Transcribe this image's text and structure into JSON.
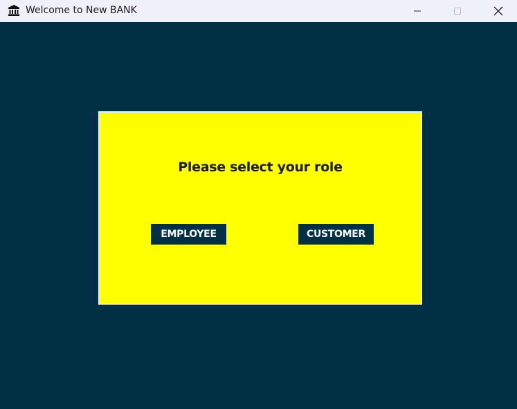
{
  "window": {
    "title": "Welcome to New BANK",
    "icon": "bank-icon"
  },
  "panel": {
    "prompt": "Please select your role",
    "background_color": "#ffff00",
    "buttons": {
      "employee_label": "EMPLOYEE",
      "customer_label": "CUSTOMER"
    }
  },
  "colors": {
    "client_background": "#013045",
    "button_background": "#013045",
    "button_text": "#ffffff"
  }
}
